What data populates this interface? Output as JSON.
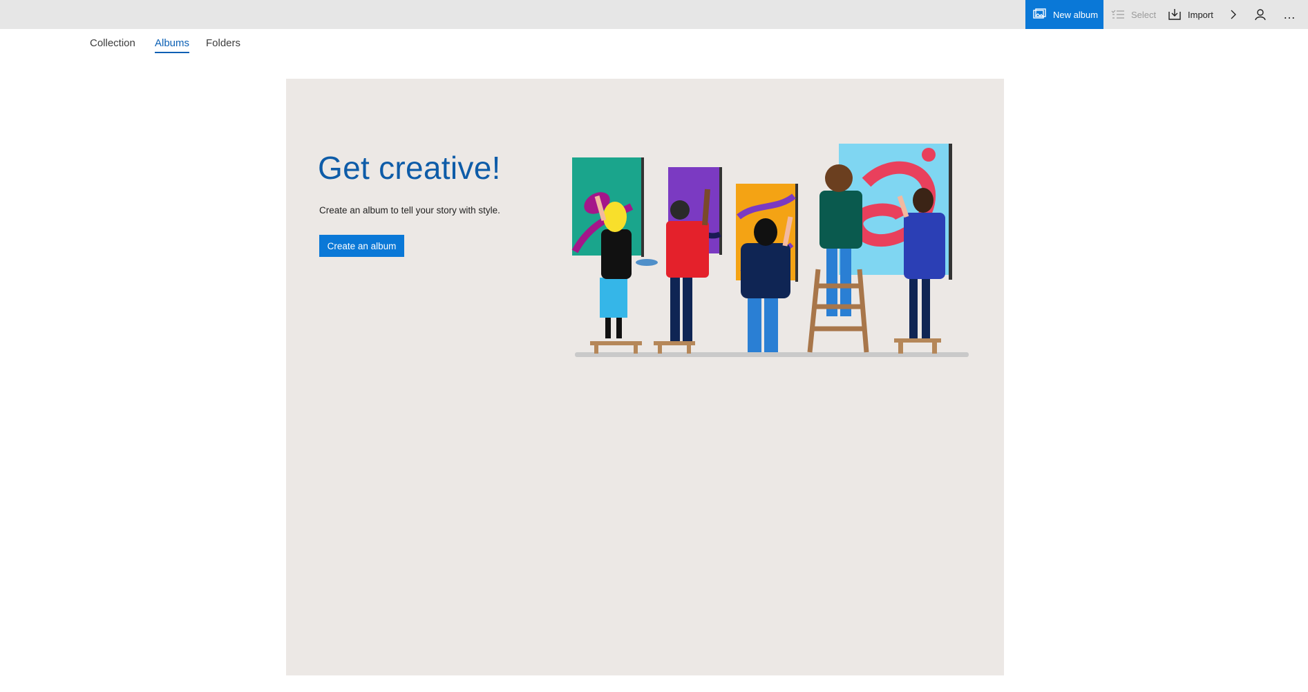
{
  "toolbar": {
    "new_album_label": "New album",
    "select_label": "Select",
    "import_label": "Import",
    "more_glyph": "…",
    "accent_color": "#0a78d7"
  },
  "nav": {
    "tabs": [
      {
        "label": "Collection",
        "active": false
      },
      {
        "label": "Albums",
        "active": true
      },
      {
        "label": "Folders",
        "active": false
      }
    ]
  },
  "hero": {
    "title": "Get creative!",
    "description": "Create an album to tell your story with style.",
    "button_label": "Create an album",
    "illustration": "people-painting-canvases-illustration"
  },
  "colors": {
    "panel_bg": "#ece8e5",
    "title": "#0e5ca8",
    "active_tab": "#0a5fb4"
  }
}
